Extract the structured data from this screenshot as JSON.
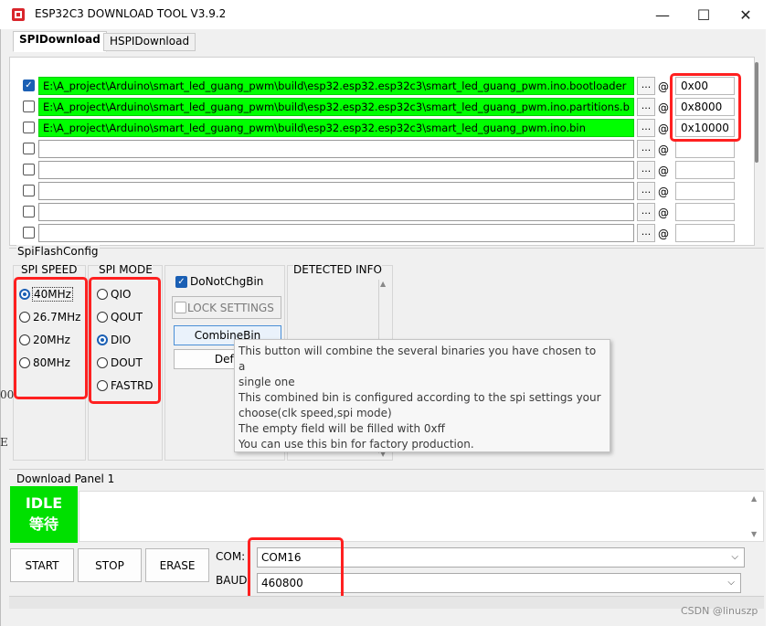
{
  "window": {
    "title": "ESP32C3 DOWNLOAD TOOL V3.9.2",
    "minimize": "—",
    "maximize": "☐",
    "close": "✕"
  },
  "tabs": [
    {
      "label": "SPIDownload",
      "active": true
    },
    {
      "label": "HSPIDownload",
      "active": false
    }
  ],
  "files": [
    {
      "checked": true,
      "path": "E:\\A_project\\Arduino\\smart_led_guang_pwm\\build\\esp32.esp32.esp32c3\\smart_led_guang_pwm.ino.bootloader",
      "address": "0x00"
    },
    {
      "checked": false,
      "path": "E:\\A_project\\Arduino\\smart_led_guang_pwm\\build\\esp32.esp32.esp32c3\\smart_led_guang_pwm.ino.partitions.b",
      "address": "0x8000"
    },
    {
      "checked": false,
      "path": "E:\\A_project\\Arduino\\smart_led_guang_pwm\\build\\esp32.esp32.esp32c3\\smart_led_guang_pwm.ino.bin",
      "address": "0x10000"
    },
    {
      "checked": false,
      "path": "",
      "address": ""
    },
    {
      "checked": false,
      "path": "",
      "address": ""
    },
    {
      "checked": false,
      "path": "",
      "address": ""
    },
    {
      "checked": false,
      "path": "",
      "address": ""
    }
  ],
  "browse_label": "...",
  "at_label": "@",
  "config": {
    "section_label": "SpiFlashConfig",
    "spi_speed_label": "SPI SPEED",
    "spi_speeds": [
      "40MHz",
      "26.7MHz",
      "20MHz",
      "80MHz"
    ],
    "spi_speed_selected": 0,
    "spi_mode_label": "SPI MODE",
    "spi_modes": [
      "QIO",
      "QOUT",
      "DIO",
      "DOUT",
      "FASTRD"
    ],
    "spi_mode_selected": 2,
    "donotchgbin_label": "DoNotChgBin",
    "lock_settings_label": "LOCK SETTINGS",
    "combinebin_label": "CombineBin",
    "default_label": "Defa",
    "detected_info_label": "DETECTED INFO"
  },
  "tooltip": {
    "lines": [
      "This button will combine the several binaries you have chosen to a",
      "single one",
      "This combined bin is configured according to the spi settings your",
      "choose(clk speed,spi mode)",
      "The empty field will be filled with 0xff",
      "You can use this bin for factory production."
    ]
  },
  "download_panel": {
    "label": "Download Panel 1",
    "status_en": "IDLE",
    "status_cn": "等待",
    "start_label": "START",
    "stop_label": "STOP",
    "erase_label": "ERASE",
    "com_label": "COM:",
    "com_value": "COM16",
    "baud_label": "BAUD:",
    "baud_value": "460800"
  },
  "watermark": "CSDN @linuszp",
  "edge_chars": [
    "00",
    "E"
  ]
}
